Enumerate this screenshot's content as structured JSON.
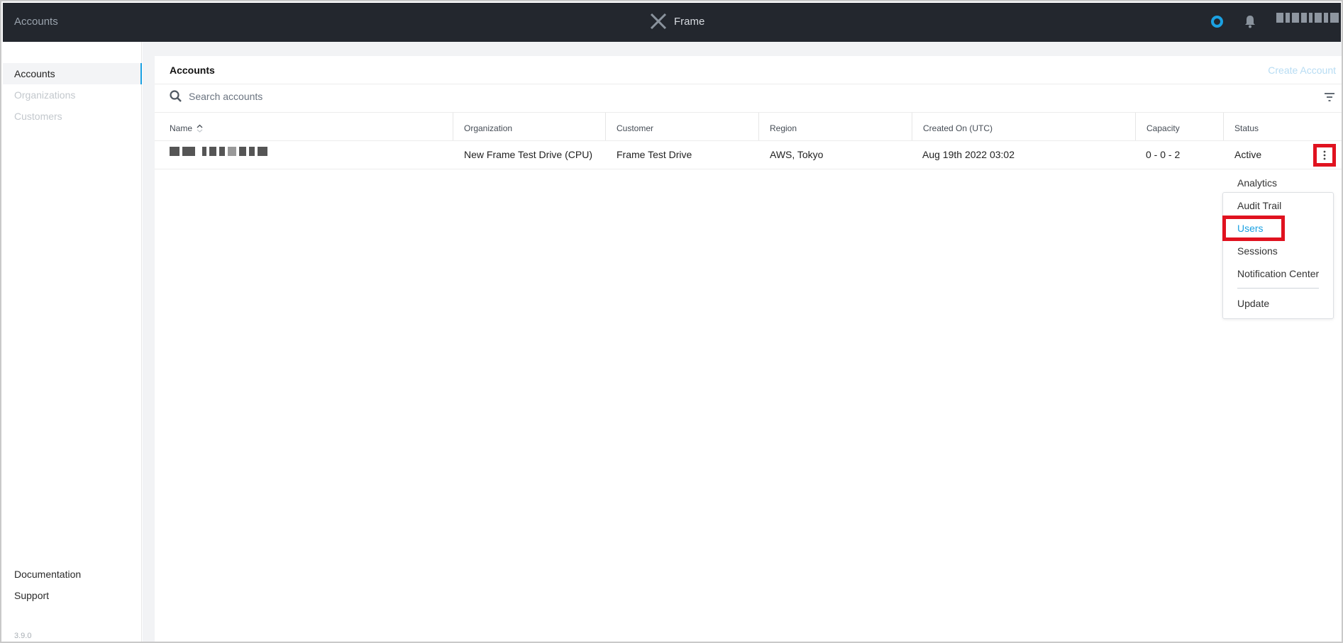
{
  "topbar": {
    "breadcrumb": "Accounts",
    "brand": "Frame",
    "status_color": "#1ba1e2"
  },
  "sidebar": {
    "items": [
      {
        "label": "Accounts",
        "active": true
      },
      {
        "label": "Organizations",
        "active": false
      },
      {
        "label": "Customers",
        "active": false
      }
    ],
    "bottom_links": [
      "Documentation",
      "Support"
    ],
    "version": "3.9.0"
  },
  "panel": {
    "title": "Accounts",
    "create_button": "Create Account",
    "search_placeholder": "Search accounts"
  },
  "table": {
    "columns": [
      "Name",
      "Organization",
      "Customer",
      "Region",
      "Created On (UTC)",
      "Capacity",
      "Status"
    ],
    "rows": [
      {
        "name": "",
        "organization": "New Frame Test Drive (CPU)",
        "customer": "Frame Test Drive",
        "region": "AWS, Tokyo",
        "created_on": "Aug 19th 2022 03:02",
        "capacity": "0 - 0 - 2",
        "status": "Active"
      }
    ]
  },
  "menu": {
    "items": [
      "Analytics",
      "Audit Trail",
      "Users",
      "Sessions",
      "Notification Center",
      "Update"
    ],
    "highlighted": "Users"
  },
  "colors": {
    "accent": "#1ba1e2",
    "highlight_box": "#e0121f",
    "topbar_bg": "#23272e"
  }
}
